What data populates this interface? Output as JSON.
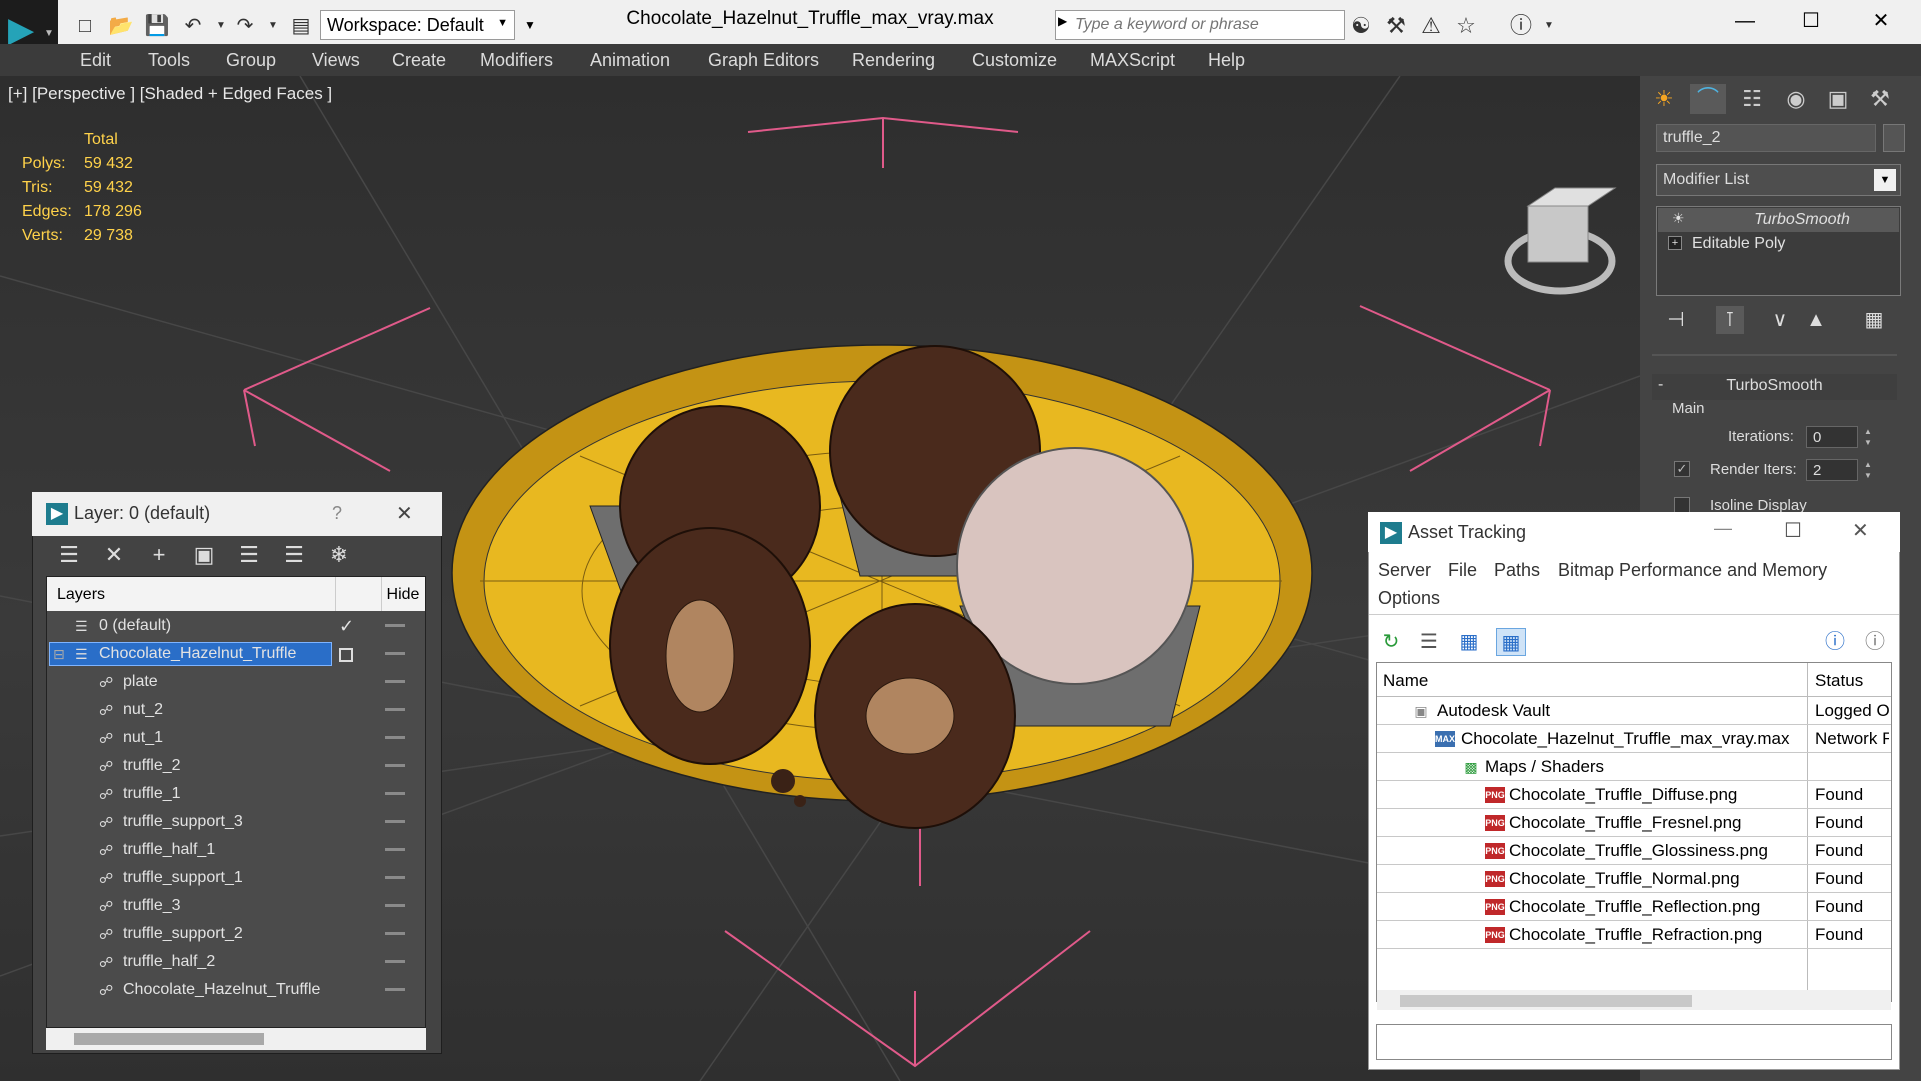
{
  "titlebar": {
    "workspace": "Workspace: Default",
    "title": "Chocolate_Hazelnut_Truffle_max_vray.max",
    "search_placeholder": "Type a keyword or phrase"
  },
  "menu": [
    "Edit",
    "Tools",
    "Group",
    "Views",
    "Create",
    "Modifiers",
    "Animation",
    "Graph Editors",
    "Rendering",
    "Customize",
    "MAXScript",
    "Help"
  ],
  "viewport": {
    "label": "[+] [Perspective ] [Shaded + Edged Faces ]",
    "stats_header": "Total",
    "stats": [
      {
        "label": "Polys:",
        "value": "59 432"
      },
      {
        "label": "Tris:",
        "value": "59 432"
      },
      {
        "label": "Edges:",
        "value": "178 296"
      },
      {
        "label": "Verts:",
        "value": "29 738"
      }
    ]
  },
  "command_panel": {
    "object_name": "truffle_2",
    "modifier_list": "Modifier List",
    "stack": [
      "TurboSmooth",
      "Editable Poly"
    ],
    "rollout_title": "TurboSmooth",
    "group_main": "Main",
    "iterations_label": "Iterations:",
    "iterations_value": "0",
    "render_iters_label": "Render Iters:",
    "render_iters_value": "2",
    "isoline_label": "Isoline Display"
  },
  "layer_dialog": {
    "title": "Layer: 0 (default)",
    "help": "?",
    "col_layers": "Layers",
    "col_hide": "Hide",
    "rows": [
      {
        "name": "0 (default)",
        "level": 0
      },
      {
        "name": "Chocolate_Hazelnut_Truffle",
        "level": 0
      },
      {
        "name": "plate",
        "level": 1
      },
      {
        "name": "nut_2",
        "level": 1
      },
      {
        "name": "nut_1",
        "level": 1
      },
      {
        "name": "truffle_2",
        "level": 1
      },
      {
        "name": "truffle_1",
        "level": 1
      },
      {
        "name": "truffle_support_3",
        "level": 1
      },
      {
        "name": "truffle_half_1",
        "level": 1
      },
      {
        "name": "truffle_support_1",
        "level": 1
      },
      {
        "name": "truffle_3",
        "level": 1
      },
      {
        "name": "truffle_support_2",
        "level": 1
      },
      {
        "name": "truffle_half_2",
        "level": 1
      },
      {
        "name": "Chocolate_Hazelnut_Truffle",
        "level": 1
      }
    ]
  },
  "asset_dialog": {
    "title": "Asset Tracking",
    "menu": [
      "Server",
      "File",
      "Paths",
      "Bitmap Performance and Memory",
      "Options"
    ],
    "col_name": "Name",
    "col_status": "Status",
    "rows": [
      {
        "name": "Autodesk Vault",
        "status": "Logged O"
      },
      {
        "name": "Chocolate_Hazelnut_Truffle_max_vray.max",
        "status": "Network F"
      },
      {
        "name": "Maps / Shaders",
        "status": ""
      },
      {
        "name": "Chocolate_Truffle_Diffuse.png",
        "status": "Found"
      },
      {
        "name": "Chocolate_Truffle_Fresnel.png",
        "status": "Found"
      },
      {
        "name": "Chocolate_Truffle_Glossiness.png",
        "status": "Found"
      },
      {
        "name": "Chocolate_Truffle_Normal.png",
        "status": "Found"
      },
      {
        "name": "Chocolate_Truffle_Reflection.png",
        "status": "Found"
      },
      {
        "name": "Chocolate_Truffle_Refraction.png",
        "status": "Found"
      }
    ]
  },
  "colors": {
    "plate": "#e8b820",
    "chocolate": "#4a2a1c",
    "selection": "#2a6ec8",
    "stats": "#ffd24a",
    "gizmo": "#e05a8a"
  }
}
